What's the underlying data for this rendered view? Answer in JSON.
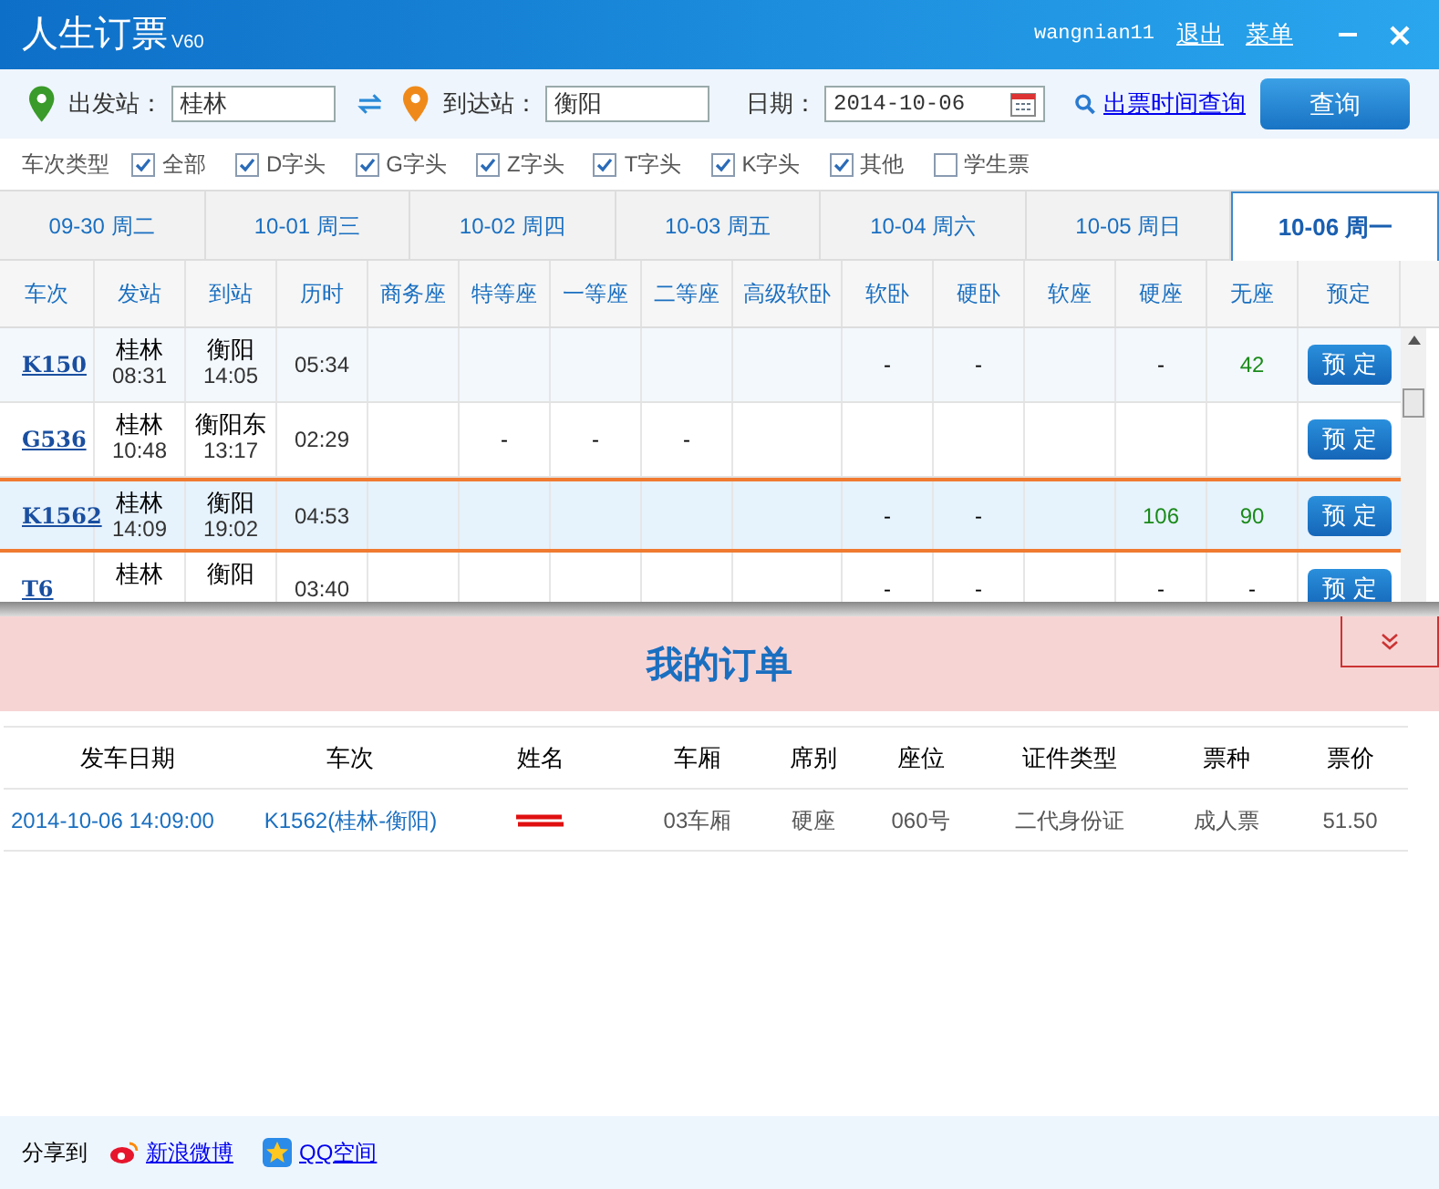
{
  "window": {
    "title": "人生订票",
    "version": "V60",
    "user": "wangnian11",
    "links": [
      "退出",
      "菜单"
    ]
  },
  "search": {
    "from_label": "出发站：",
    "from": "桂林",
    "to_label": "到达站：",
    "to": "衡阳",
    "date_label": "日期：",
    "date": "2014-10-06",
    "time_link": "出票时间查询",
    "button": "查询"
  },
  "filters": {
    "label": "车次类型",
    "items": [
      {
        "label": "全部",
        "checked": true
      },
      {
        "label": "D字头",
        "checked": true
      },
      {
        "label": "G字头",
        "checked": true
      },
      {
        "label": "Z字头",
        "checked": true
      },
      {
        "label": "T字头",
        "checked": true
      },
      {
        "label": "K字头",
        "checked": true
      },
      {
        "label": "其他",
        "checked": true
      },
      {
        "label": "学生票",
        "checked": false
      }
    ]
  },
  "date_tabs": [
    {
      "date": "09-30",
      "weekday": "周二",
      "selected": false
    },
    {
      "date": "10-01",
      "weekday": "周三",
      "selected": false
    },
    {
      "date": "10-02",
      "weekday": "周四",
      "selected": false
    },
    {
      "date": "10-03",
      "weekday": "周五",
      "selected": false
    },
    {
      "date": "10-04",
      "weekday": "周六",
      "selected": false
    },
    {
      "date": "10-05",
      "weekday": "周日",
      "selected": false
    },
    {
      "date": "10-06",
      "weekday": "周一",
      "selected": true
    }
  ],
  "trains": {
    "columns": [
      "车次",
      "发站",
      "到站",
      "历时",
      "商务座",
      "特等座",
      "一等座",
      "二等座",
      "高级软卧",
      "软卧",
      "硬卧",
      "软座",
      "硬座",
      "无座",
      "预定"
    ],
    "rows": [
      {
        "train": "K150",
        "from": "桂林",
        "depart": "08:31",
        "to": "衡阳",
        "arrive": "14:05",
        "duration": "05:34",
        "seats": {
          "soft_sleeper": {
            "text": "-"
          },
          "hard_sleeper": {
            "text": "-"
          },
          "hard_seat": {
            "text": "-"
          },
          "standing": {
            "text": "42",
            "kind": "count"
          }
        },
        "button": "预 定",
        "selected": false
      },
      {
        "train": "G536",
        "from": "桂林",
        "depart": "10:48",
        "to": "衡阳东",
        "arrive": "13:17",
        "duration": "02:29",
        "seats": {
          "premium": {
            "text": "-"
          },
          "first_class": {
            "text": "-"
          },
          "second_class": {
            "text": "-"
          }
        },
        "button": "预 定",
        "selected": false
      },
      {
        "train": "K1562",
        "from": "桂林",
        "depart": "14:09",
        "to": "衡阳",
        "arrive": "19:02",
        "duration": "04:53",
        "seats": {
          "soft_sleeper": {
            "text": "-"
          },
          "hard_sleeper": {
            "text": "-"
          },
          "hard_seat": {
            "text": "106",
            "kind": "count"
          },
          "standing": {
            "text": "90",
            "kind": "count"
          }
        },
        "button": "预 定",
        "selected": true
      },
      {
        "train": "T6",
        "from": "桂林",
        "to": "衡阳",
        "duration": "03:40",
        "seats": {
          "soft_sleeper": {
            "text": "-"
          },
          "hard_sleeper": {
            "text": "-"
          },
          "hard_seat": {
            "text": "-"
          },
          "standing": {
            "text": "-"
          }
        },
        "button": "预 定",
        "selected": false
      }
    ]
  },
  "orders": {
    "title": "我的订单",
    "columns": [
      "发车日期",
      "车次",
      "姓名",
      "车厢",
      "席别",
      "座位",
      "证件类型",
      "票种",
      "票价"
    ],
    "rows": [
      {
        "date": "2014-10-06 14:09:00",
        "train": "K1562(桂林-衡阳)",
        "car": "03车厢",
        "class": "硬座",
        "seat": "060号",
        "id_type": "二代身份证",
        "ticket_type": "成人票",
        "price": "51.50"
      }
    ]
  },
  "footer": {
    "label": "分享到",
    "links": [
      "新浪微博",
      "QQ空间"
    ]
  }
}
